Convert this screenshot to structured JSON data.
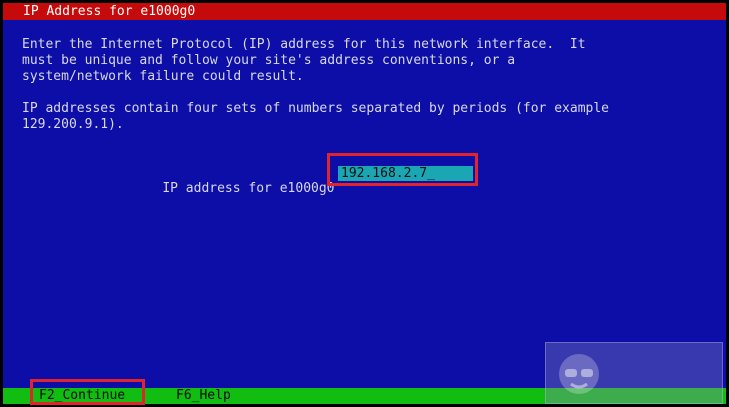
{
  "window": {
    "title": "IP Address for e1000g0"
  },
  "instructions": {
    "paragraph1": "Enter the Internet Protocol (IP) address for this network interface.  It\nmust be unique and follow your site's address conventions, or a\nsystem/network failure could result.",
    "paragraph2": "IP addresses contain four sets of numbers separated by periods (for example\n129.200.9.1)."
  },
  "form": {
    "ip_label": "IP address for e1000g0",
    "ip_value": "192.168.2.7",
    "cursor": "_"
  },
  "footer": {
    "keys": [
      {
        "label": "F2_Continue"
      },
      {
        "label": "F6_Help"
      }
    ]
  },
  "colors": {
    "background": "#0d0da8",
    "title_bar": "#c40a0a",
    "footer_bar": "#11bd11",
    "input_field": "#1aa6b3",
    "highlight": "#e0232d"
  },
  "watermark": {
    "icon": "mascot-icon"
  }
}
